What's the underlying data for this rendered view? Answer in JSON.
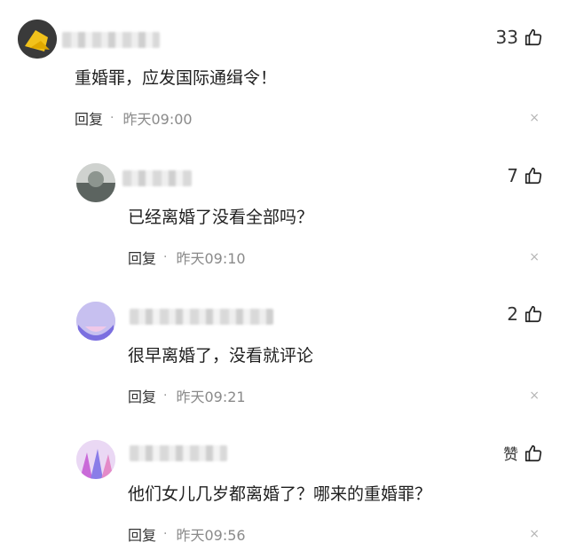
{
  "comments": [
    {
      "text": "重婚罪，应发国际通缉令！",
      "likes": "33",
      "reply_label": "回复",
      "separator": "·",
      "time": "昨天09:00",
      "close_glyph": "×"
    },
    {
      "text": "已经离婚了没看全部吗？",
      "likes": "7",
      "reply_label": "回复",
      "separator": "·",
      "time": "昨天09:10",
      "close_glyph": "×"
    },
    {
      "text": "很早离婚了，没看就评论",
      "likes": "2",
      "reply_label": "回复",
      "separator": "·",
      "time": "昨天09:21",
      "close_glyph": "×"
    },
    {
      "text": "他们女儿几岁都离婚了？哪来的重婚罪？",
      "likes": "赞",
      "reply_label": "回复",
      "separator": "·",
      "time": "昨天09:56",
      "close_glyph": "×"
    }
  ],
  "colors": {
    "text": "#1f1f1f",
    "muted": "#8a8a8a",
    "close": "#b5b5b5"
  },
  "icons": {
    "like": "thumbs-up-icon",
    "close": "close-icon"
  }
}
